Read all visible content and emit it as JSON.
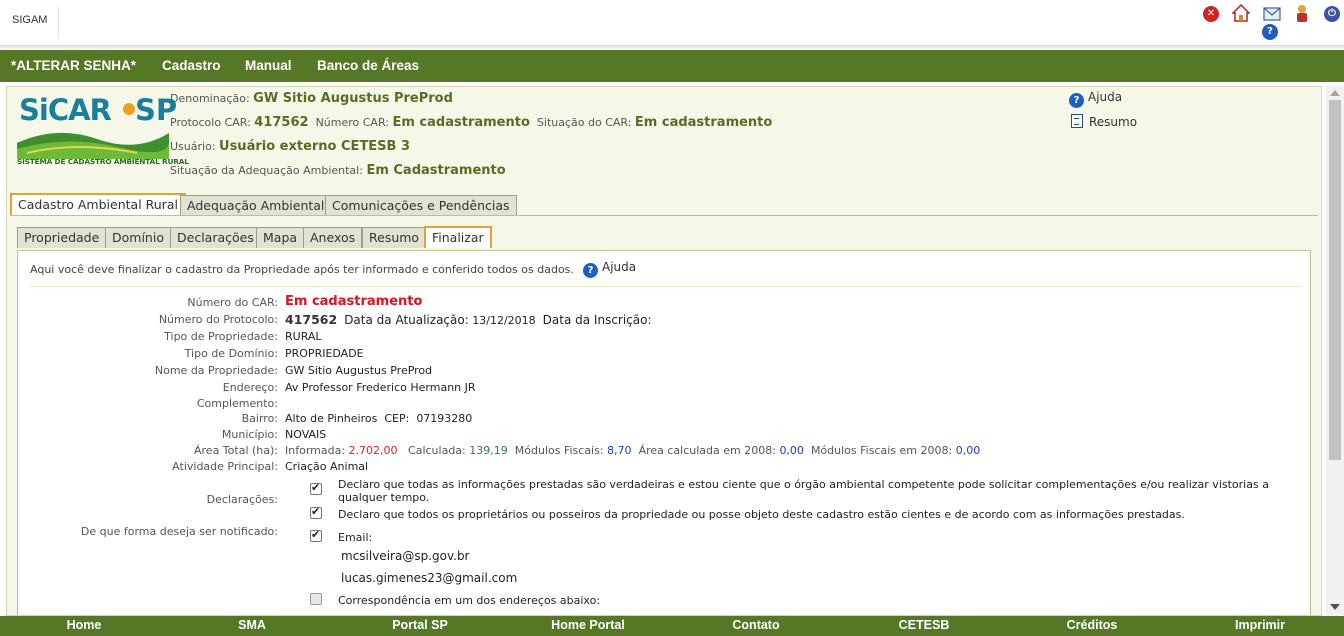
{
  "app": {
    "title": "SIGAM"
  },
  "topbar_icons": [
    "close-icon",
    "home-icon",
    "mail-icon",
    "user-icon",
    "logout-icon",
    "help-icon"
  ],
  "nav": {
    "items": [
      "*ALTERAR SENHA*",
      "Cadastro",
      "Manual",
      "Banco de Áreas"
    ]
  },
  "logo": {
    "text": "SiCAR",
    "suffix": "SP",
    "caption": "SISTEMA DE CADASTRO AMBIENTAL RURAL"
  },
  "header": {
    "denominacao_label": "Denominação:",
    "denominacao_value": "GW Sitio Augustus PreProd",
    "protocolo_label": "Protocolo CAR:",
    "protocolo_value": "417562",
    "numero_car_label": "Número CAR:",
    "numero_car_value": "Em cadastramento",
    "situacao_car_label": "Situação do CAR:",
    "situacao_car_value": "Em cadastramento",
    "usuario_label": "Usuário:",
    "usuario_value": "Usuário externo CETESB 3",
    "situacao_adeq_label": "Situação da Adequação Ambiental:",
    "situacao_adeq_value": "Em Cadastramento",
    "ajuda": "Ajuda",
    "resumo": "Resumo"
  },
  "main_tabs": [
    "Cadastro Ambiental Rural",
    "Adequação Ambiental",
    "Comunicações e Pendências"
  ],
  "sub_tabs": [
    "Propriedade",
    "Domínio",
    "Declarações",
    "Mapa",
    "Anexos",
    "Resumo",
    "Finalizar"
  ],
  "content": {
    "intro": "Aqui você deve finalizar o cadastro da Propriedade após ter informado e conferido todos os dados.",
    "ajuda": "Ajuda",
    "labels": {
      "numero_car": "Número do CAR:",
      "numero_protocolo": "Número do Protocolo:",
      "tipo_propriedade": "Tipo de Propriedade:",
      "tipo_dominio": "Tipo de Domínio:",
      "nome_propriedade": "Nome da Propriedade:",
      "endereco": "Endereço:",
      "complemento": "Complemento:",
      "bairro": "Bairro:",
      "municipio": "Município:",
      "area_total": "Área Total (ha):",
      "atividade": "Atividade Principal:",
      "declaracoes": "Declarações:",
      "notificacao": "De que forma deseja ser notificado:"
    },
    "values": {
      "numero_car": "Em cadastramento",
      "numero_protocolo": "417562",
      "data_atualizacao_label": "Data da Atualização:",
      "data_atualizacao": "13/12/2018",
      "data_inscricao_label": "Data da Inscrição:",
      "tipo_propriedade": "RURAL",
      "tipo_dominio": "PROPRIEDADE",
      "nome_propriedade": "GW Sitio Augustus PreProd",
      "endereco": "Av Professor Frederico Hermann JR",
      "complemento": "",
      "bairro": "Alto de Pinheiros",
      "cep_label": "CEP:",
      "cep": "07193280",
      "municipio": "NOVAIS",
      "informada_label": "Informada:",
      "informada": "2.702,00",
      "calculada_label": "Calculada:",
      "calculada": "139,19",
      "modulos_label": "Módulos Fiscais:",
      "modulos": "8,70",
      "area2008_label": "Área calculada em 2008:",
      "area2008": "0,00",
      "modulos2008_label": "Módulos Fiscais em 2008:",
      "modulos2008": "0,00",
      "atividade": "Criação Animal"
    },
    "declaracoes": [
      {
        "checked": true,
        "text": "Declaro que todas as informações prestadas são verdadeiras e estou ciente que o órgão ambiental competente pode solicitar complementações e/ou realizar vistorias a qualquer tempo."
      },
      {
        "checked": true,
        "text": "Declaro que todos os proprietários ou posseiros da propriedade ou posse objeto deste cadastro estão cientes e de acordo com as informações prestadas."
      }
    ],
    "notificacao": {
      "email_label": "Email:",
      "email_checked": true,
      "emails": [
        "mcsilveira@sp.gov.br",
        "lucas.gimenes23@gmail.com"
      ],
      "correspondencia_label": "Correspondência em um dos endereços abaixo:",
      "correspondencia_checked": false
    }
  },
  "footer": {
    "items": [
      "Home",
      "SMA",
      "Portal SP",
      "Home Portal",
      "Contato",
      "CETESB",
      "Créditos",
      "Imprimir"
    ]
  },
  "colors": {
    "nav_green": "#567826",
    "panel_bg": "#f5f8e9",
    "active_tab_border": "#e2a23a",
    "header_value": "#5a6b25",
    "alert_red": "#e0121b"
  }
}
